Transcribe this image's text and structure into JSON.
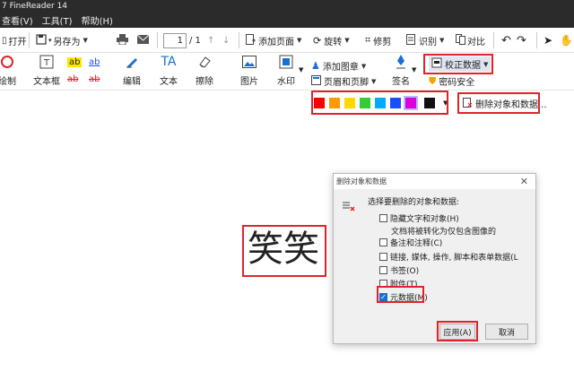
{
  "app": {
    "title": "7 FineReader 14"
  },
  "menu": [
    "查看(V)",
    "工具(T)",
    "帮助(H)"
  ],
  "toolbar": {
    "open": "打开",
    "save_as": "另存为",
    "page_current": "1",
    "page_total": "/ 1",
    "add_page": "添加页面",
    "rotate": "旋转",
    "repair": "修剪",
    "recognize": "识别",
    "compare": "对比"
  },
  "ribbon": {
    "draw": "绘制",
    "textbox": "文本框",
    "edit": "编辑",
    "text": "文本",
    "erase": "擦除",
    "image": "图片",
    "watermark": "水印",
    "add_pattern": "添加图章",
    "header_footer": "页眉和页脚",
    "sign": "签名",
    "correct_data": "校正数据",
    "password_security": "密码安全",
    "delete_objects": "删除对象和数据..."
  },
  "colors": [
    "#ff0000",
    "#ff9900",
    "#ffd800",
    "#33cc33",
    "#00aaff",
    "#1a4fff",
    "#dd00dd",
    "#111111"
  ],
  "document": {
    "text": "笑笑"
  },
  "dialog": {
    "title": "删除对象和数据",
    "prompt": "选择要删除的对象和数据:",
    "options": [
      {
        "label": "隐藏文字和对象(H)",
        "checked": false
      },
      {
        "label": "备注和注释(C)",
        "checked": false
      },
      {
        "label": "链接, 媒体, 操作, 脚本和表单数据(L",
        "checked": false
      },
      {
        "label": "书签(O)",
        "checked": false
      },
      {
        "label": "附件(T)",
        "checked": false
      },
      {
        "label": "元数据(M)",
        "checked": true
      }
    ],
    "option_note": "文档将被转化为仅包含图像的",
    "apply": "应用(A)",
    "cancel": "取消"
  }
}
